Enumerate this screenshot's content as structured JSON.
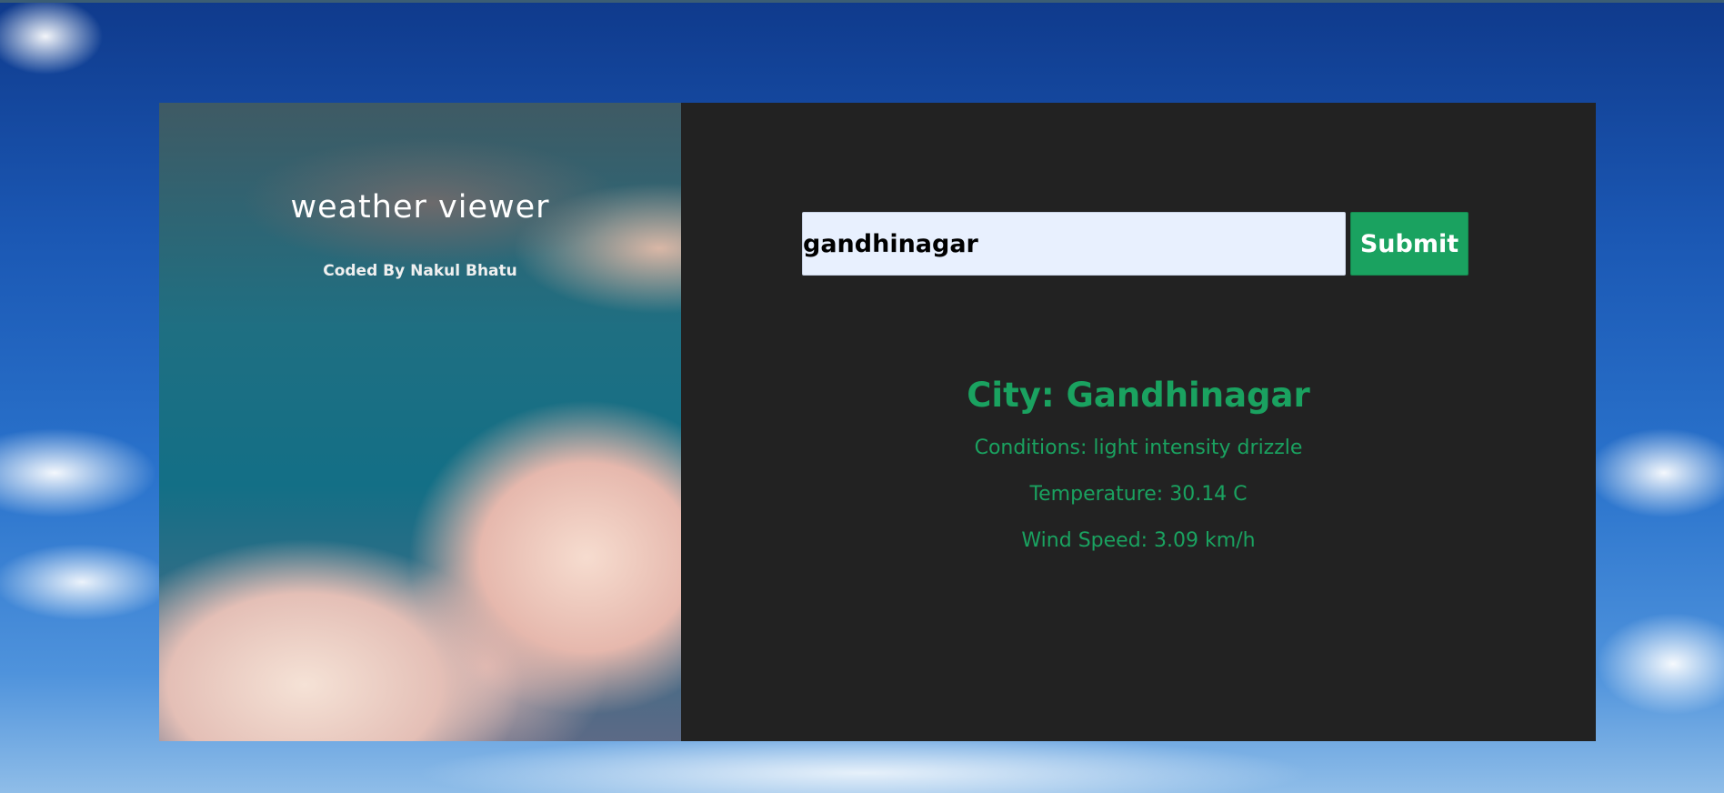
{
  "app": {
    "title": "weather viewer",
    "credit": "Coded By Nakul Bhatu"
  },
  "search": {
    "value": "gandhinagar",
    "submit_label": "Submit"
  },
  "result": {
    "city": "City: Gandhinagar",
    "conditions": "Conditions: light intensity drizzle",
    "temperature": "Temperature: 30.14 C",
    "wind": "Wind Speed: 3.09 km/h"
  },
  "colors": {
    "accent": "#1aa260",
    "panel_bg": "#222222",
    "input_bg": "#e8f0fe"
  }
}
